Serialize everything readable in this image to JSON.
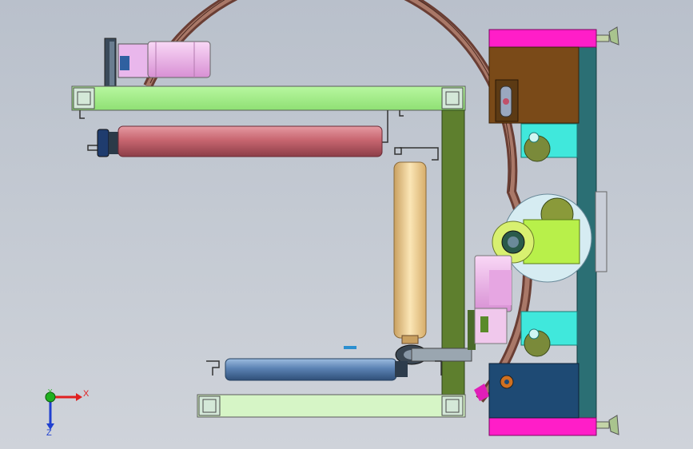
{
  "viewport": {
    "background_top": "#b9c0cb",
    "background_bottom": "#cfd3da"
  },
  "triad": {
    "x_label": "X",
    "y_label": "Y",
    "z_label": "Z",
    "x_color": "#e02020",
    "y_color": "#20b020",
    "z_color": "#2040d0"
  },
  "components": [
    "stepper-motor-top",
    "frame-beam-top",
    "roller-red",
    "frame-post-vertical",
    "roller-yellow",
    "roller-blue",
    "frame-beam-bottom",
    "ring-gear",
    "drive-housing-brown",
    "drive-housing-navy",
    "side-plate",
    "idler-gears",
    "leveling-feet",
    "gear-motor-pink"
  ],
  "colors": {
    "frame_green": "#a6f08c",
    "frame_light": "#d6f5c6",
    "post_olive": "#5e7f2e",
    "roller_red": "#c86670",
    "roller_yellow": "#f0cc8a",
    "roller_blue": "#5b82b3",
    "ring_brown": "#8a5a4a",
    "housing_brown": "#7a4a18",
    "housing_navy": "#1e4a74",
    "magenta": "#ff1ec8",
    "teal_plate": "#2b6f74",
    "cyan_block": "#40e8dc",
    "motor_pink": "#f0b8ec"
  }
}
